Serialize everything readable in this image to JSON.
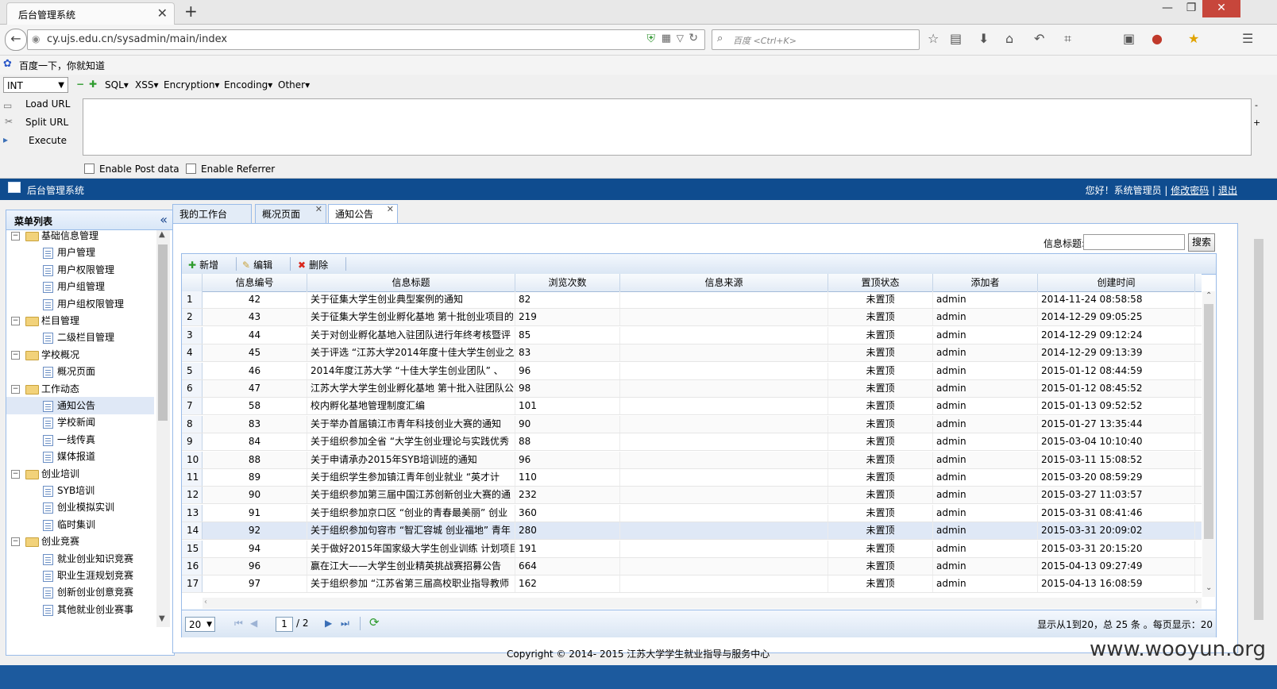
{
  "browser": {
    "tab_title": "后台管理系统",
    "url": "cy.ujs.edu.cn/sysadmin/main/index",
    "search_placeholder": "百度 <Ctrl+K>",
    "bookmark": "百度一下，你就知道"
  },
  "hackbar": {
    "type_select": "INT",
    "menus": [
      "SQL▾",
      "XSS▾",
      "Encryption▾",
      "Encoding▾",
      "Other▾"
    ],
    "load_url": "Load URL",
    "split_url": "Split URL",
    "execute": "Execute",
    "enable_post": "Enable Post data",
    "enable_referrer": "Enable Referrer"
  },
  "app": {
    "title": "后台管理系统",
    "greeting": "您好！系统管理员",
    "change_password": "修改密码",
    "logout": "退出"
  },
  "sidebar": {
    "title": "菜单列表",
    "collapse": "«",
    "tree": [
      {
        "label": "基础信息管理",
        "type": "group"
      },
      {
        "label": "用户管理",
        "type": "child"
      },
      {
        "label": "用户权限管理",
        "type": "child"
      },
      {
        "label": "用户组管理",
        "type": "child"
      },
      {
        "label": "用户组权限管理",
        "type": "child"
      },
      {
        "label": "栏目管理",
        "type": "group"
      },
      {
        "label": "二级栏目管理",
        "type": "child"
      },
      {
        "label": "学校概况",
        "type": "group"
      },
      {
        "label": "概况页面",
        "type": "child"
      },
      {
        "label": "工作动态",
        "type": "group"
      },
      {
        "label": "通知公告",
        "type": "child",
        "selected": true
      },
      {
        "label": "学校新闻",
        "type": "child"
      },
      {
        "label": "一线传真",
        "type": "child"
      },
      {
        "label": "媒体报道",
        "type": "child"
      },
      {
        "label": "创业培训",
        "type": "group"
      },
      {
        "label": "SYB培训",
        "type": "child"
      },
      {
        "label": "创业模拟实训",
        "type": "child"
      },
      {
        "label": "临时集训",
        "type": "child"
      },
      {
        "label": "创业竞赛",
        "type": "group"
      },
      {
        "label": "就业创业知识竞赛",
        "type": "child"
      },
      {
        "label": "职业生涯规划竞赛",
        "type": "child"
      },
      {
        "label": "创新创业创意竞赛",
        "type": "child"
      },
      {
        "label": "其他就业创业赛事",
        "type": "child"
      }
    ]
  },
  "tabs": [
    "我的工作台",
    "概况页面",
    "通知公告"
  ],
  "search": {
    "label": "信息标题:",
    "button": "搜索"
  },
  "toolbar": {
    "add": "新增",
    "edit": "编辑",
    "delete": "删除"
  },
  "grid": {
    "columns": [
      "信息编号",
      "信息标题",
      "浏览次数",
      "信息来源",
      "置顶状态",
      "添加者",
      "创建时间"
    ],
    "rows": [
      [
        "1",
        "42",
        "关于征集大学生创业典型案例的通知",
        "82",
        "",
        "未置顶",
        "admin",
        "2014-11-24 08:58:58"
      ],
      [
        "2",
        "43",
        "关于征集大学生创业孵化基地 第十批创业项目的",
        "219",
        "",
        "未置顶",
        "admin",
        "2014-12-29 09:05:25"
      ],
      [
        "3",
        "44",
        "关于对创业孵化基地入驻团队进行年终考核暨评",
        "85",
        "",
        "未置顶",
        "admin",
        "2014-12-29 09:12:24"
      ],
      [
        "4",
        "45",
        "关于评选 “江苏大学2014年度十佳大学生创业之",
        "83",
        "",
        "未置顶",
        "admin",
        "2014-12-29 09:13:39"
      ],
      [
        "5",
        "46",
        "2014年度江苏大学 “十佳大学生创业团队” 、",
        "96",
        "",
        "未置顶",
        "admin",
        "2015-01-12 08:44:59"
      ],
      [
        "6",
        "47",
        "江苏大学大学生创业孵化基地 第十批入驻团队公",
        "98",
        "",
        "未置顶",
        "admin",
        "2015-01-12 08:45:52"
      ],
      [
        "7",
        "58",
        "校内孵化基地管理制度汇编",
        "101",
        "",
        "未置顶",
        "admin",
        "2015-01-13 09:52:52"
      ],
      [
        "8",
        "83",
        "关于举办首届镇江市青年科技创业大赛的通知",
        "90",
        "",
        "未置顶",
        "admin",
        "2015-01-27 13:35:44"
      ],
      [
        "9",
        "84",
        "关于组织参加全省 “大学生创业理论与实践优秀",
        "88",
        "",
        "未置顶",
        "admin",
        "2015-03-04 10:10:40"
      ],
      [
        "10",
        "88",
        "关于申请承办2015年SYB培训班的通知",
        "96",
        "",
        "未置顶",
        "admin",
        "2015-03-11 15:08:52"
      ],
      [
        "11",
        "89",
        "关于组织学生参加镇江青年创业就业 “英才计",
        "110",
        "",
        "未置顶",
        "admin",
        "2015-03-20 08:59:29"
      ],
      [
        "12",
        "90",
        "关于组织参加第三届中国江苏创新创业大赛的通",
        "232",
        "",
        "未置顶",
        "admin",
        "2015-03-27 11:03:57"
      ],
      [
        "13",
        "91",
        "关于组织参加京口区 “创业的青春最美丽” 创业",
        "360",
        "",
        "未置顶",
        "admin",
        "2015-03-31 08:41:46"
      ],
      [
        "14",
        "92",
        "关于组织参加句容市 “智汇容城 创业福地” 青年",
        "280",
        "",
        "未置顶",
        "admin",
        "2015-03-31 20:09:02"
      ],
      [
        "15",
        "94",
        "关于做好2015年国家级大学生创业训练 计划项目",
        "191",
        "",
        "未置顶",
        "admin",
        "2015-03-31 20:15:20"
      ],
      [
        "16",
        "96",
        "赢在江大——大学生创业精英挑战赛招募公告",
        "664",
        "",
        "未置顶",
        "admin",
        "2015-04-13 09:27:49"
      ],
      [
        "17",
        "97",
        "关于组织参加 “江苏省第三届高校职业指导教师",
        "162",
        "",
        "未置顶",
        "admin",
        "2015-04-13 16:08:59"
      ]
    ],
    "selected_row": 14
  },
  "pager": {
    "page_size": "20",
    "current_page": "1",
    "total_pages": "/ 2",
    "summary": "显示从1到20，总 25 条 。每页显示：20"
  },
  "footer": "Copyright © 2014- 2015 江苏大学学生就业指导与服务中心",
  "watermark": "www.wooyun.org"
}
